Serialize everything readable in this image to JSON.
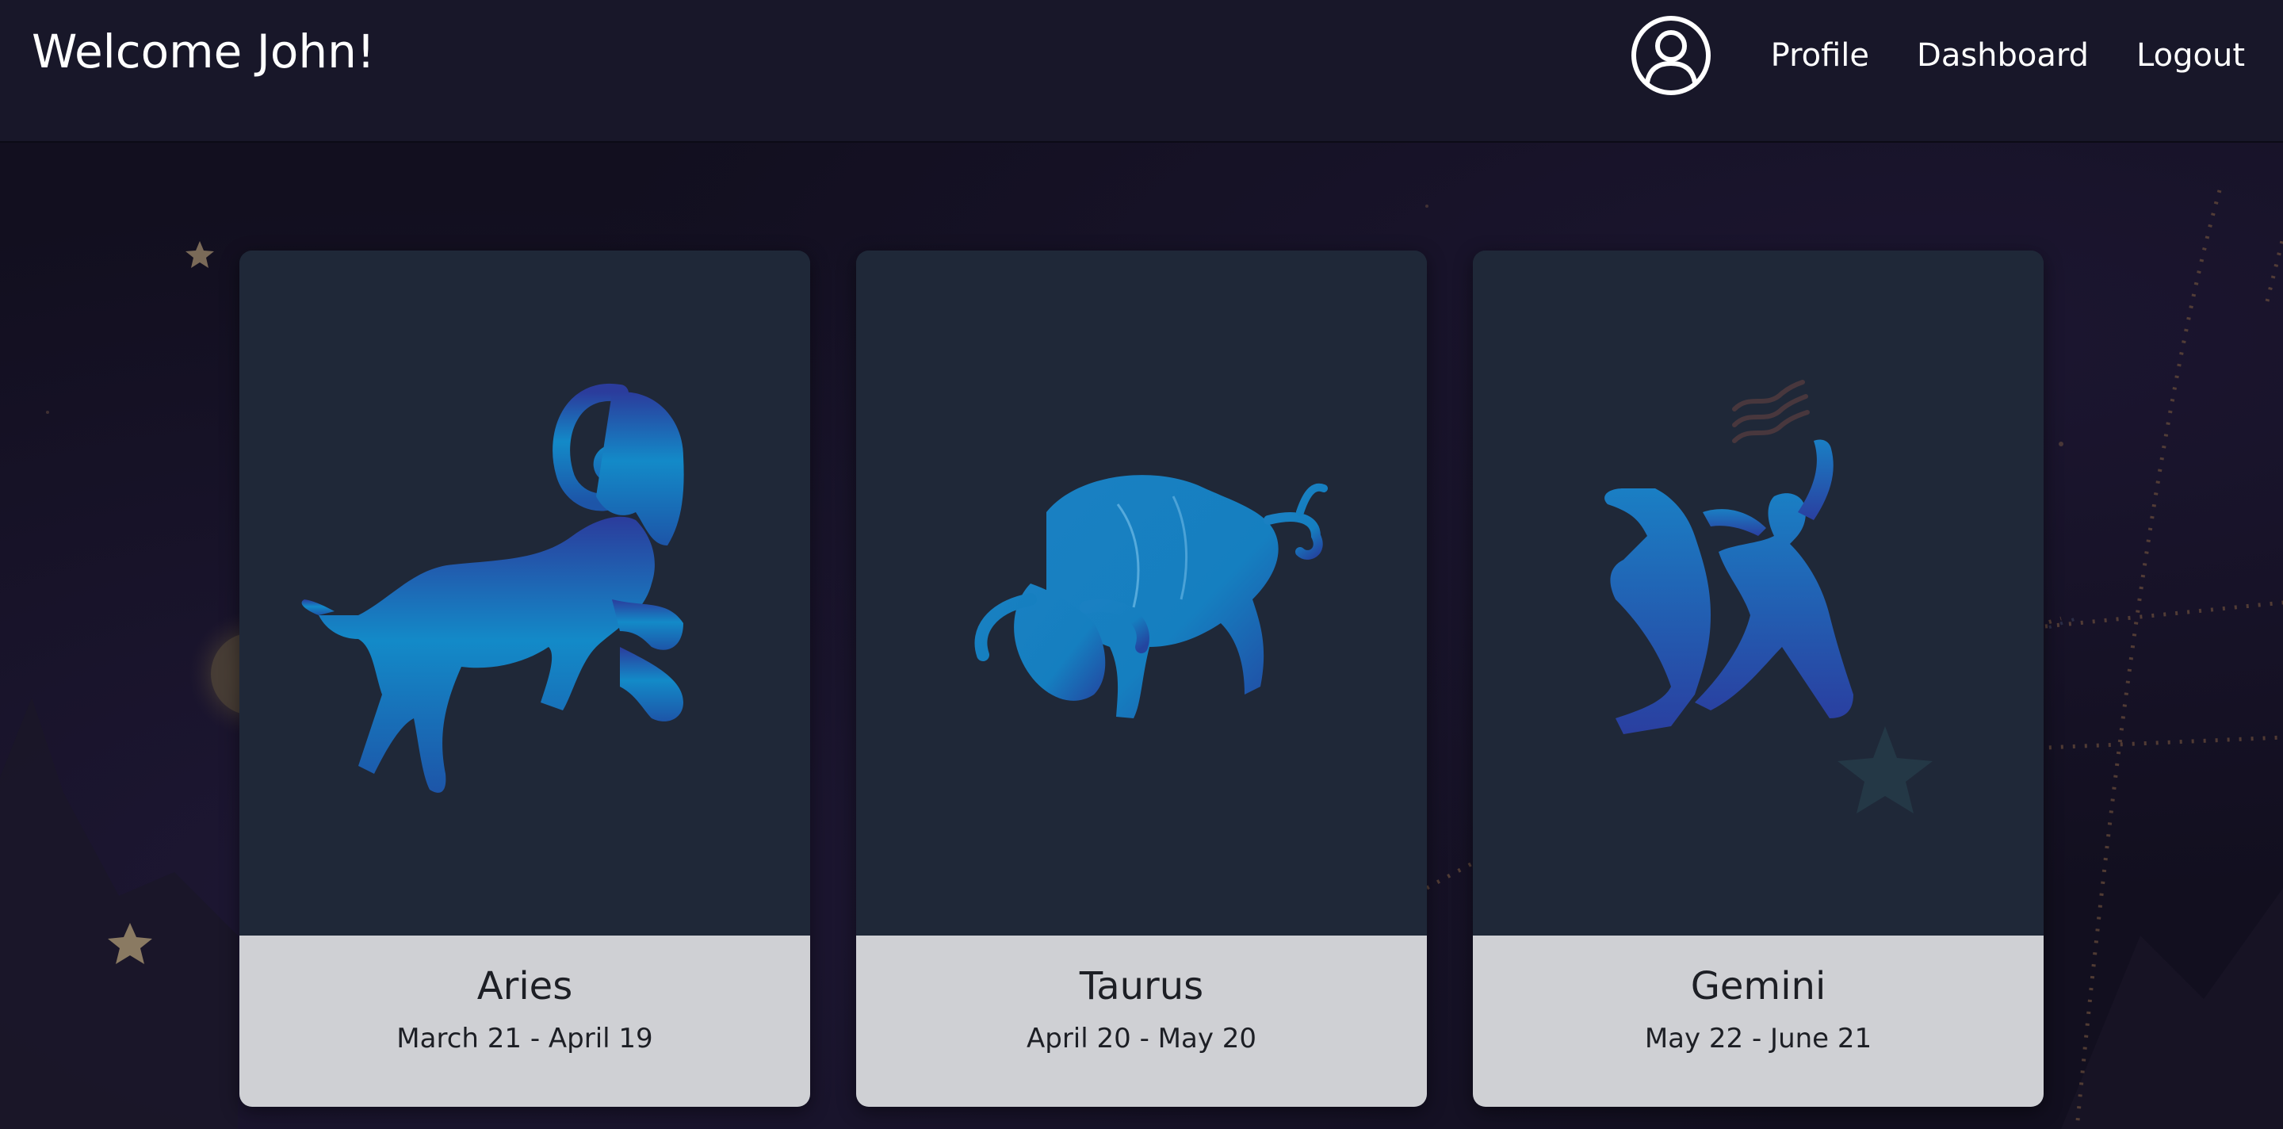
{
  "header": {
    "welcome": "Welcome John!",
    "avatar_icon": "user-circle-icon",
    "nav": [
      {
        "label": "Profile"
      },
      {
        "label": "Dashboard"
      },
      {
        "label": "Logout"
      }
    ]
  },
  "cards": [
    {
      "name": "Aries",
      "dates": "March 21 - April 19",
      "icon": "ram-icon"
    },
    {
      "name": "Taurus",
      "dates": "April 20 - May 20",
      "icon": "bull-icon"
    },
    {
      "name": "Gemini",
      "dates": "May 22 - June 21",
      "icon": "twins-icon"
    }
  ],
  "colors": {
    "background": "#120f1f",
    "navbar": "#181729",
    "card_image_bg": "#1f2838",
    "card_body_bg": "#cfd0d4",
    "sign_blue": "#1287c9"
  }
}
